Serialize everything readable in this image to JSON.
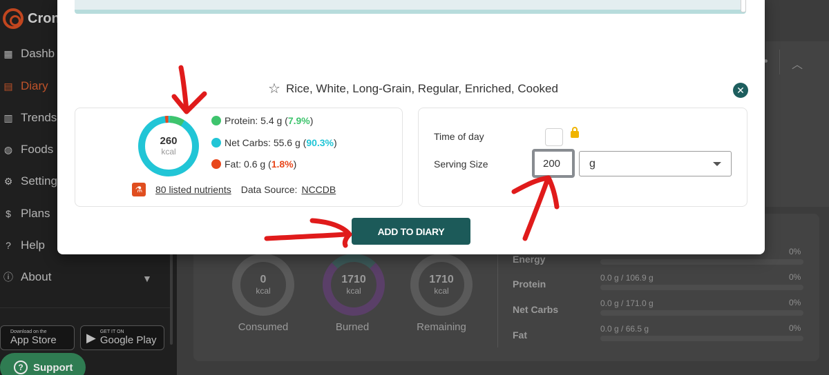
{
  "sidebar": {
    "brand": "Cron",
    "items": [
      {
        "label": "Dashb",
        "icon": "grid-icon"
      },
      {
        "label": "Diary",
        "icon": "book-icon",
        "active": true
      },
      {
        "label": "Trends",
        "icon": "chart-icon"
      },
      {
        "label": "Foods",
        "icon": "apple-icon"
      },
      {
        "label": "Setting",
        "icon": "gear-icon"
      },
      {
        "label": "Plans",
        "icon": "dollar-icon"
      },
      {
        "label": "Help",
        "icon": "help-icon"
      },
      {
        "label": "About",
        "icon": "info-icon"
      }
    ],
    "app_store": {
      "small": "Download on the",
      "big": "App Store"
    },
    "google_play": {
      "small": "GET IT ON",
      "big": "Google Play"
    },
    "support_label": "Support"
  },
  "modal": {
    "food_title": "Rice, White, Long-Grain, Regular, Enriched, Cooked",
    "energy": {
      "value": "260",
      "unit": "kcal"
    },
    "macros": [
      {
        "name": "Protein:",
        "amount": "5.4 g",
        "pct": "7.9%",
        "color": "#3ec46d"
      },
      {
        "name": "Net Carbs:",
        "amount": "55.6 g",
        "pct": "90.3%",
        "color": "#21c5d6"
      },
      {
        "name": "Fat:",
        "amount": "0.6 g",
        "pct": "1.8%",
        "color": "#e8471c"
      }
    ],
    "nutrients_link": "80 listed nutrients",
    "data_source_label": "Data Source:",
    "data_source_value": "NCCDB",
    "time_of_day_label": "Time of day",
    "serving_size_label": "Serving Size",
    "serving_value": "200",
    "unit_value": "g",
    "add_button": "ADD TO DIARY"
  },
  "background": {
    "rings": [
      {
        "value": "0",
        "unit": "kcal",
        "label": "Consumed"
      },
      {
        "value": "1710",
        "unit": "kcal",
        "label": "Burned"
      },
      {
        "value": "1710",
        "unit": "kcal",
        "label": "Remaining"
      }
    ],
    "targets": [
      {
        "name": "Energy",
        "value": "",
        "pct": "0%"
      },
      {
        "name": "Protein",
        "value": "0.0 g / 106.9 g",
        "pct": "0%"
      },
      {
        "name": "Net Carbs",
        "value": "0.0 g / 171.0 g",
        "pct": "0%"
      },
      {
        "name": "Fat",
        "value": "0.0 g / 66.5 g",
        "pct": "0%"
      }
    ]
  },
  "colors": {
    "accent": "#1c5a59",
    "protein": "#3ec46d",
    "carbs": "#21c5d6",
    "fat": "#e8471c",
    "annotation": "#e01b1b"
  }
}
